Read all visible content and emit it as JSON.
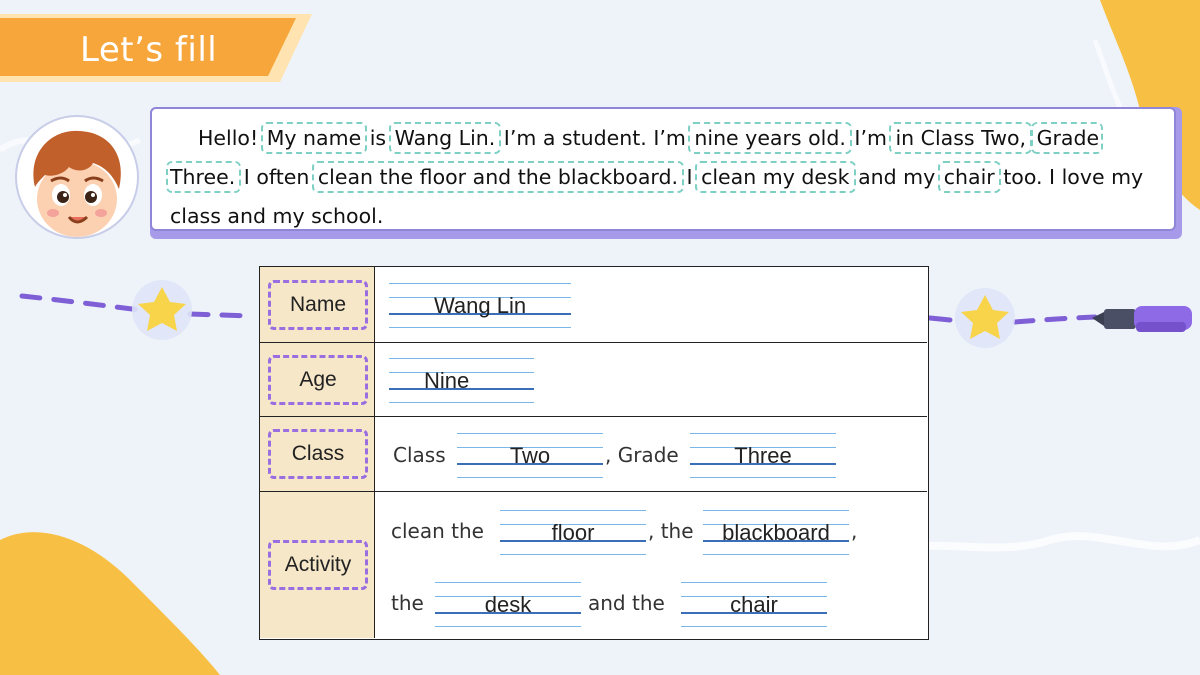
{
  "header": {
    "title": "Let’s fill"
  },
  "passage": {
    "segments": [
      "Hello! ",
      "My name",
      " is ",
      "Wang Lin.",
      " I’m a student. I’m ",
      "nine years old.",
      " I’m ",
      "in Class Two,",
      " ",
      "Grade Three.",
      " I often ",
      "clean the floor and the blackboard.",
      " I ",
      "clean my desk",
      " and my ",
      "chair",
      " too. I love my class and my school."
    ]
  },
  "table": {
    "name": {
      "label": "Name",
      "answer": "Wang Lin"
    },
    "age": {
      "label": "Age",
      "answer": "Nine"
    },
    "class": {
      "label": "Class",
      "prefix": "Class",
      "answer1": "Two",
      "middle": ", Grade",
      "answer2": "Three"
    },
    "activity": {
      "label": "Activity",
      "line1_prefix": "clean the",
      "answer1": "floor",
      "line1_mid": ", the",
      "answer2": "blackboard",
      "line1_end": ",",
      "line2_prefix": "the",
      "answer3": "desk",
      "line2_mid": "and the",
      "answer4": "chair"
    }
  },
  "colors": {
    "banner": "#f7a63b",
    "highlight": "#7fd0c4",
    "label_border": "#9a6ee0",
    "label_fill": "#f6e7c9",
    "accent_purple": "#8f86d8"
  }
}
